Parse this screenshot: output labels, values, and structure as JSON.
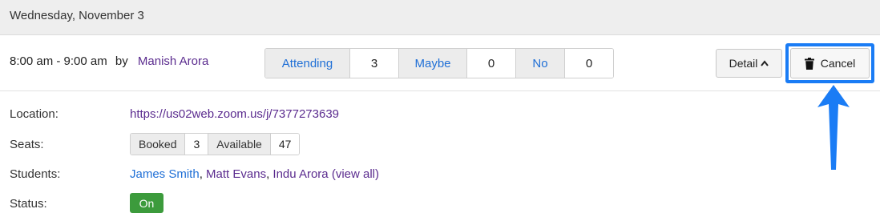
{
  "header": {
    "date": "Wednesday, November 3"
  },
  "session": {
    "time": "8:00 am - 9:00 am",
    "by": "by",
    "host": "Manish Arora",
    "rsvp": {
      "attending_label": "Attending",
      "attending_count": "3",
      "maybe_label": "Maybe",
      "maybe_count": "0",
      "no_label": "No",
      "no_count": "0"
    },
    "detail_label": "Detail",
    "cancel_label": "Cancel"
  },
  "details": {
    "location_label": "Location:",
    "location_value": "https://us02web.zoom.us/j/7377273639",
    "seats_label": "Seats:",
    "booked_label": "Booked",
    "booked_value": "3",
    "available_label": "Available",
    "available_value": "47",
    "students_label": "Students:",
    "student_1": "James Smith",
    "student_2": "Matt Evans",
    "student_3": "Indu Arora",
    "view_all": "view all",
    "status_label": "Status:",
    "status_value": "On"
  },
  "colors": {
    "accent": "#1a7cf5",
    "link_purple": "#5b2c8f",
    "link_blue": "#1f6fd6",
    "status_on": "#3c9b3c"
  },
  "icons": {
    "cancel": "trash-icon",
    "detail": "caret-up-icon",
    "annotation": "arrow-up-icon"
  }
}
